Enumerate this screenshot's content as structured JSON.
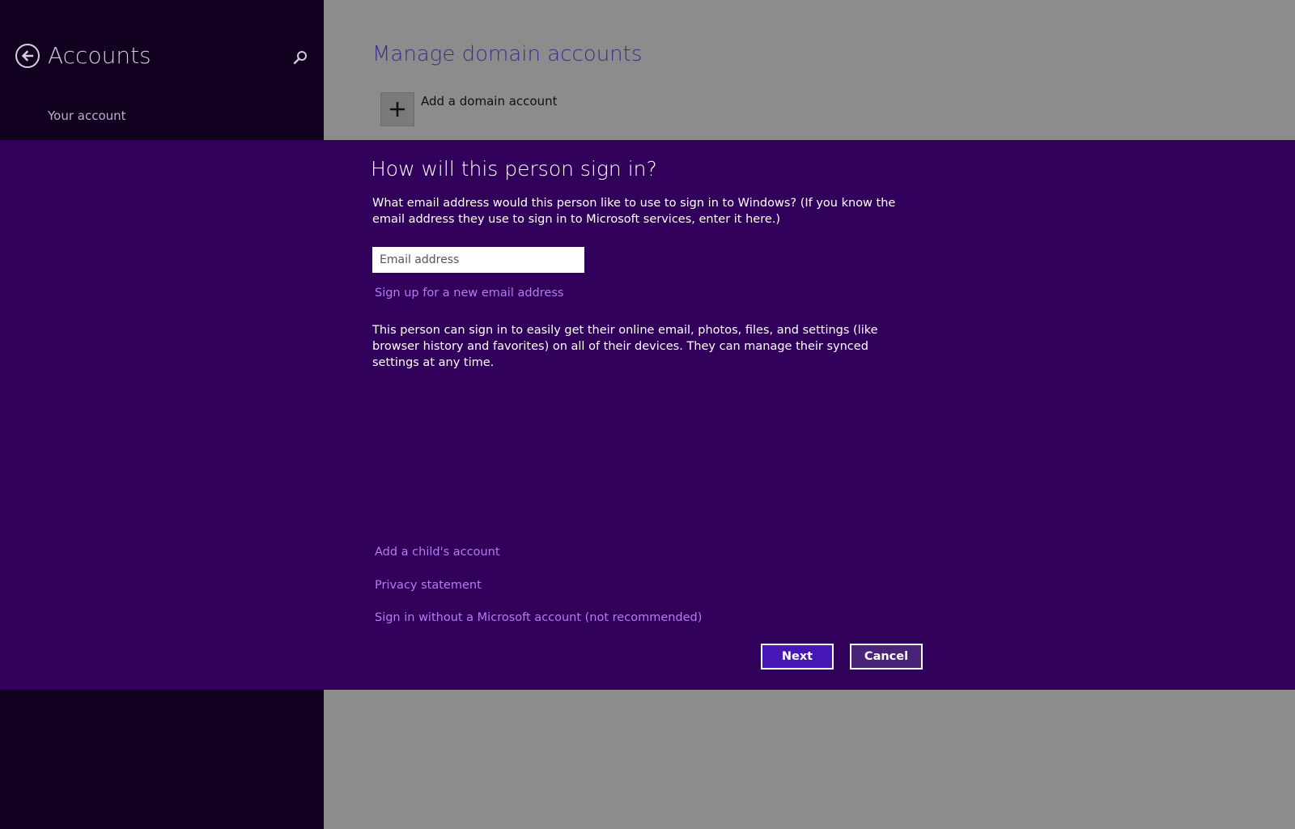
{
  "left_pane": {
    "title": "Accounts",
    "nav_items": [
      {
        "label": "Your account"
      }
    ]
  },
  "main": {
    "title": "Manage domain accounts",
    "add_label": "Add a domain account"
  },
  "dialog": {
    "title": "How will this person sign in?",
    "description": "What email address would this person like to use to sign in to Windows? (If you know the email address they use to sign in to Microsoft services, enter it here.)",
    "email": {
      "value": "",
      "placeholder": "Email address"
    },
    "signup_link": "Sign up for a new email address",
    "info": "This person can sign in to easily get their online email, photos, files, and settings (like browser history and favorites) on all of their devices. They can manage their synced settings at any time.",
    "links": {
      "child": "Add a child's account",
      "privacy": "Privacy statement",
      "no_msa": "Sign in without a Microsoft account (not recommended)"
    },
    "buttons": {
      "next": "Next",
      "cancel": "Cancel"
    }
  },
  "colors": {
    "left_pane_bg": "#11001f",
    "dialog_bg": "#31005a",
    "accent_link": "#b77bf2",
    "next_button_bg": "#4617b4",
    "main_bg": "#8c8c8c"
  },
  "icons": {
    "back": "back-arrow-circle-icon",
    "search": "search-icon",
    "add": "plus-icon"
  }
}
